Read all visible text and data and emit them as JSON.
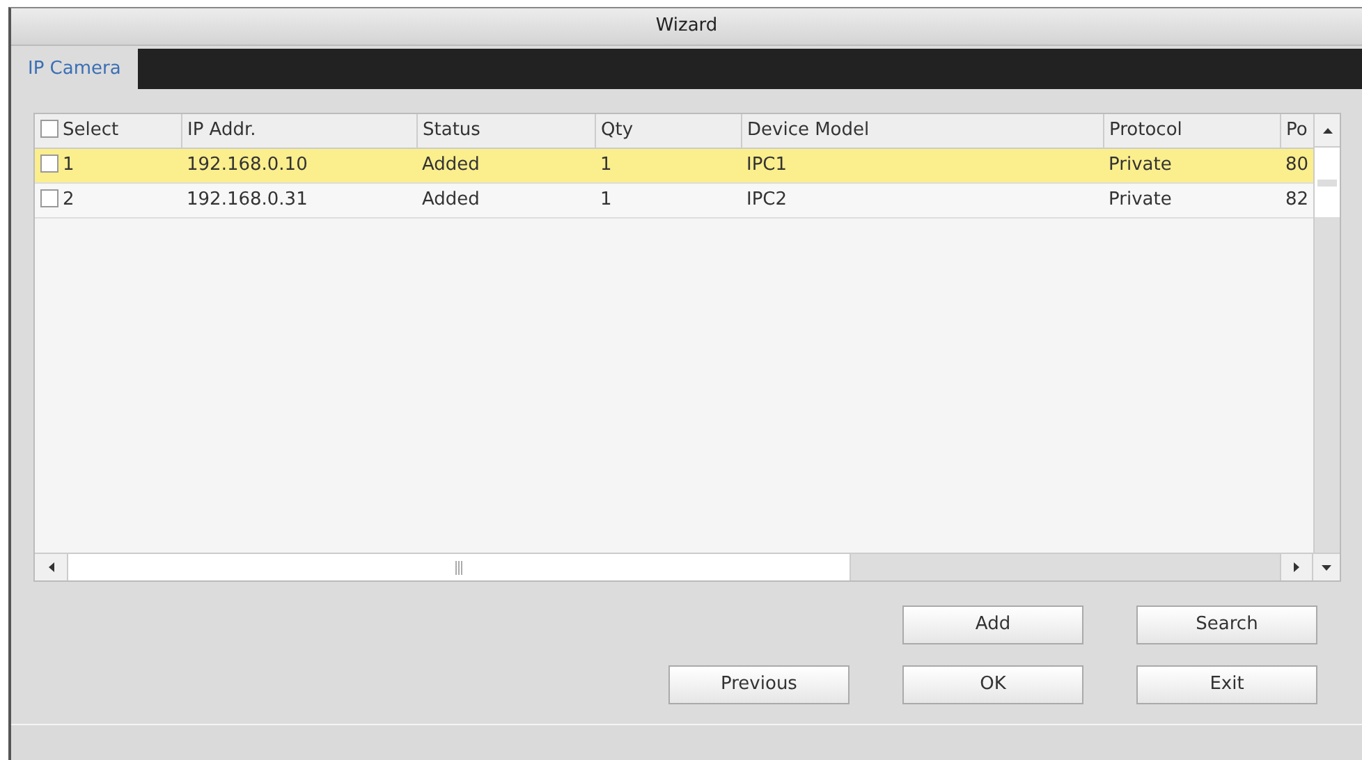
{
  "window": {
    "title": "Wizard"
  },
  "tabs": [
    {
      "label": "IP Camera",
      "selected": true
    }
  ],
  "table": {
    "columns": [
      "Select",
      "IP Addr.",
      "Status",
      "Qty",
      "Device Model",
      "Protocol",
      "Po"
    ],
    "header_checked": false,
    "rows": [
      {
        "selected": true,
        "checked": false,
        "cells": [
          "1",
          "192.168.0.10",
          "Added",
          "1",
          "IPC1",
          "Private",
          "80"
        ]
      },
      {
        "selected": false,
        "checked": false,
        "cells": [
          "2",
          "192.168.0.31",
          "Added",
          "1",
          "IPC2",
          "Private",
          "82"
        ]
      }
    ]
  },
  "button_rows": [
    [
      "Add",
      "Search"
    ],
    [
      "Previous",
      "OK",
      "Exit"
    ]
  ]
}
